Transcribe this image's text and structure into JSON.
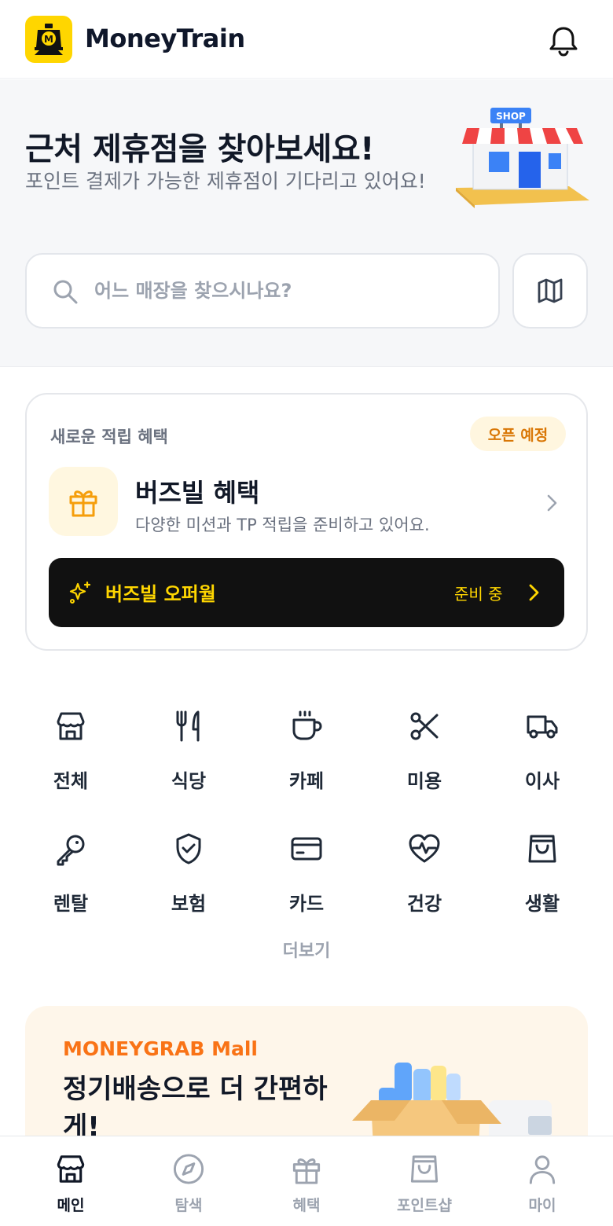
{
  "header": {
    "brand": "MoneyTrain",
    "logo_letter": "M",
    "notification_icon": "bell-icon"
  },
  "hero": {
    "title": "근처 제휴점을 찾아보세요!",
    "subtitle": "포인트 결제가 가능한 제휴점이 기다리고 있어요!",
    "illustration_sign": "SHOP",
    "search_placeholder": "어느 매장을 찾으시나요?",
    "map_icon": "map-icon"
  },
  "promo": {
    "label": "새로운 적립 혜택",
    "badge": "오픈 예정",
    "title": "버즈빌 혜택",
    "description": "다양한 미션과 TP 적립을 준비하고 있어요.",
    "offerwall_title": "버즈빌 오퍼월",
    "offerwall_status": "준비 중"
  },
  "categories": [
    {
      "label": "전체",
      "icon": "store-icon"
    },
    {
      "label": "식당",
      "icon": "utensils-icon"
    },
    {
      "label": "카페",
      "icon": "coffee-icon"
    },
    {
      "label": "미용",
      "icon": "scissors-icon"
    },
    {
      "label": "이사",
      "icon": "truck-icon"
    },
    {
      "label": "렌탈",
      "icon": "key-icon"
    },
    {
      "label": "보험",
      "icon": "shield-check-icon"
    },
    {
      "label": "카드",
      "icon": "credit-card-icon"
    },
    {
      "label": "건강",
      "icon": "heart-pulse-icon"
    },
    {
      "label": "생활",
      "icon": "shopping-bag-icon"
    }
  ],
  "more_label": "더보기",
  "mall": {
    "name": "MONEYGRAB Mall",
    "title": "정기배송으로 더 간편하게!"
  },
  "bottom_nav": [
    {
      "label": "메인",
      "icon": "store-icon",
      "active": true
    },
    {
      "label": "탐색",
      "icon": "compass-icon",
      "active": false
    },
    {
      "label": "혜택",
      "icon": "gift-icon",
      "active": false
    },
    {
      "label": "포인트샵",
      "icon": "shopping-bag-icon",
      "active": false
    },
    {
      "label": "마이",
      "icon": "user-icon",
      "active": false
    }
  ],
  "colors": {
    "brand_yellow": "#FFD600",
    "text_dark": "#111827",
    "text_muted": "#6b7280",
    "badge_orange": "#D97706",
    "mall_orange": "#F97316"
  }
}
